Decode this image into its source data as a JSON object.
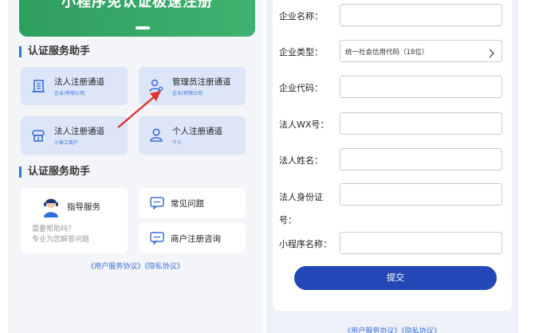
{
  "banner": {
    "title": "小程序免认证极速注册"
  },
  "left": {
    "section1_title": "认证服务助手",
    "section2_title": "认证服务助手",
    "cards": [
      {
        "title": "法人注册通道",
        "subtitle": "企业/有限公司",
        "icon": "building-icon"
      },
      {
        "title": "管理员注册通道",
        "subtitle": "企业/有限公司",
        "icon": "admin-user-icon"
      },
      {
        "title": "法人注册通道",
        "subtitle": "小体工商户",
        "icon": "shop-icon"
      },
      {
        "title": "个人注册通道",
        "subtitle": "个人",
        "icon": "person-icon"
      }
    ],
    "service": {
      "title": "指导服务",
      "hint_line1": "需要帮助吗？",
      "hint_line2": "专业为您解答问题"
    },
    "links": [
      {
        "title": "常见问题",
        "icon": "chat-icon"
      },
      {
        "title": "商户注册咨询",
        "icon": "chat-icon"
      }
    ],
    "agreement": "《用户服务协议》《隐私协议》"
  },
  "form": {
    "company_name_label": "企业名称：",
    "company_name_value": "",
    "company_type_label": "企业类型：",
    "company_type_value": "统一社会信用代码（18位）",
    "company_code_label": "企业代码：",
    "company_code_value": "",
    "legal_wx_label": "法人WX号：",
    "legal_wx_value": "",
    "legal_name_label": "法人姓名：",
    "legal_name_value": "",
    "legal_id_label_line1": "法人身份证",
    "legal_id_label_line2": "号：",
    "legal_id_value": "",
    "mini_name_label": "小程序名称：",
    "mini_name_value": "",
    "submit_label": "提交"
  },
  "right": {
    "agreement": "《用户服务协议》《隐私协议》"
  },
  "colors": {
    "accent": "#2e6fe0",
    "banner": "#3fb270",
    "submit": "#2447b8",
    "arrow": "#e0322f"
  }
}
